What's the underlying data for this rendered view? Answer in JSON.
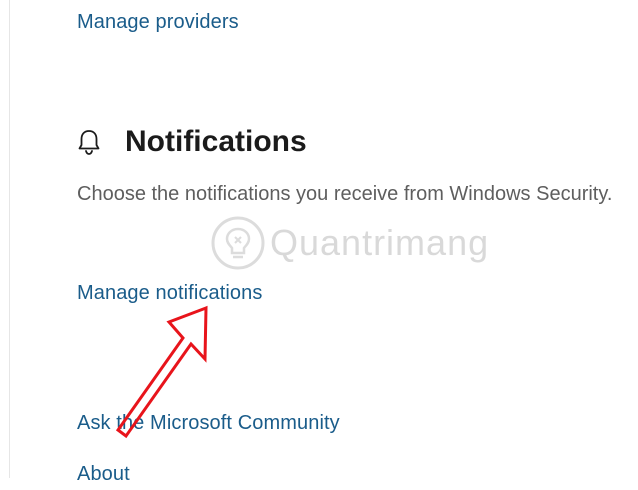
{
  "top_link": {
    "label": "Manage providers"
  },
  "notifications": {
    "icon": "bell-icon",
    "title": "Notifications",
    "description": "Choose the notifications you receive from Windows Security.",
    "manage_link": "Manage notifications"
  },
  "footer_links": {
    "community": "Ask the Microsoft Community",
    "about": "About"
  },
  "watermark": {
    "icon": "lightbulb-icon",
    "text": "Quantrimang"
  },
  "annotation": {
    "icon": "red-arrow-icon",
    "color": "#e8141b"
  },
  "colors": {
    "link": "#1a5c8a",
    "title": "#1b1b1b",
    "description": "#5e5e5e"
  }
}
